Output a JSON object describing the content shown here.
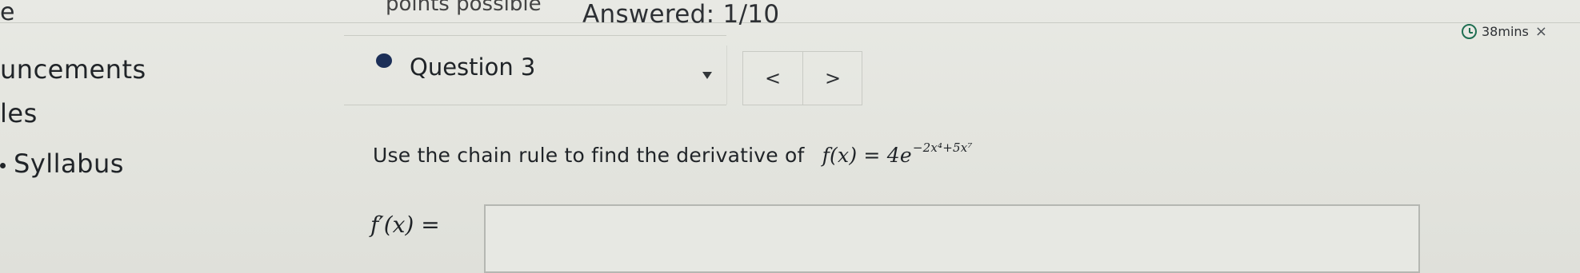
{
  "header": {
    "cut_left_text": "e",
    "points_text": "points possible",
    "answered_text": "Answered: 1/10",
    "timer_text": "38mins",
    "close_symbol": "×"
  },
  "sidebar": {
    "items": [
      {
        "label": "uncements"
      },
      {
        "label": "les"
      },
      {
        "label": "Syllabus"
      }
    ]
  },
  "question": {
    "label": "Question 3",
    "prev_symbol": "<",
    "next_symbol": ">",
    "prompt": "Use the chain rule to find the derivative of",
    "function_lhs": "f(x) = 4e",
    "function_exponent": "−2x⁴+5x⁷",
    "answer_label": "f′(x) =",
    "answer_value": ""
  },
  "icons": {
    "timer": "clock-icon",
    "close": "close-icon",
    "dropdown": "chevron-down-icon",
    "previous": "previous-icon",
    "next": "next-icon"
  },
  "colors": {
    "question_dot": "#1c2f58",
    "timer_icon": "#1f6f52"
  }
}
